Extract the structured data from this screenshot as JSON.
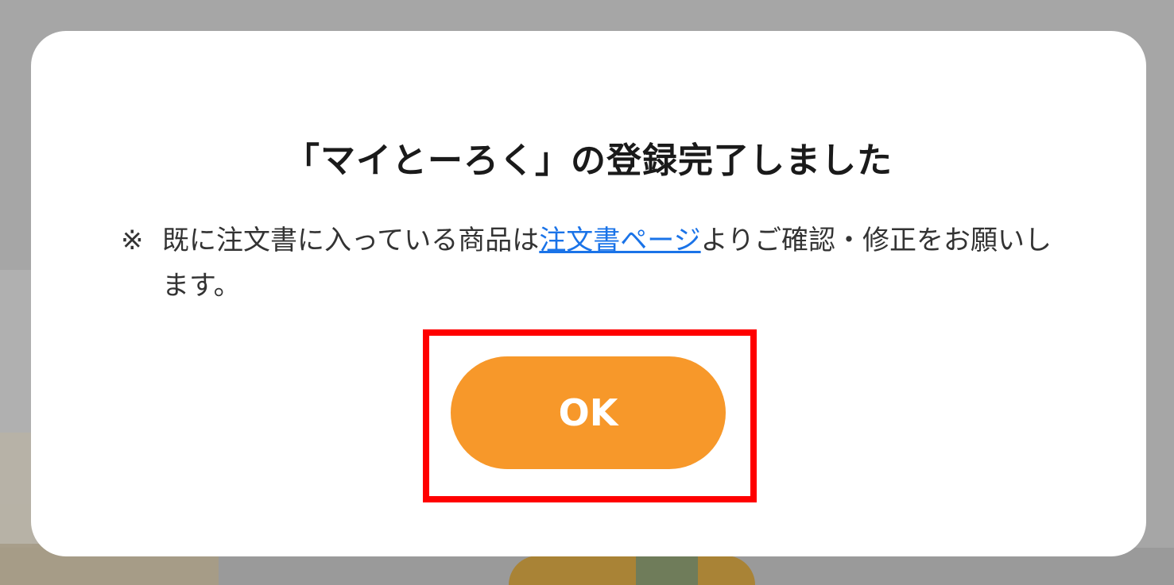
{
  "dialog": {
    "title": "「マイとーろく」の登録完了しました",
    "message": {
      "mark": "※",
      "text_before_link": "既に注文書に入っている商品は",
      "link_text": "注文書ページ",
      "text_after_link": "よりご確認・修正をお願いします。"
    },
    "ok_label": "OK"
  },
  "colors": {
    "overlay": "#a6a6a6",
    "dialog_background": "#ffffff",
    "button": "#f7982a",
    "link": "#1a73e8",
    "highlight_border": "#ff0000"
  }
}
